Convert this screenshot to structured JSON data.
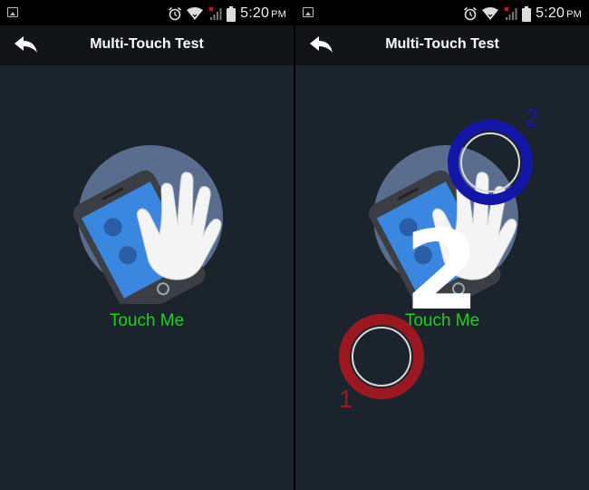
{
  "status_bar": {
    "time": "5:20",
    "ampm": "PM",
    "icons": [
      "picture-notification-icon",
      "alarm-icon",
      "wifi-icon",
      "signal-icon",
      "battery-icon"
    ]
  },
  "screens": [
    {
      "app_title": "Multi-Touch Test",
      "touch_label": "Touch Me"
    },
    {
      "app_title": "Multi-Touch Test",
      "touch_label": "Touch Me",
      "touch_count": "2",
      "touches": [
        {
          "label": "1",
          "color": "#9b1820"
        },
        {
          "label": "2",
          "color": "#1316a6"
        }
      ]
    }
  ],
  "colors": {
    "background": "#1b232c",
    "appbar": "#121417",
    "accent_green": "#17d617",
    "illustration_circle": "#5a6d8f",
    "phone_screen": "#3a87e0"
  }
}
